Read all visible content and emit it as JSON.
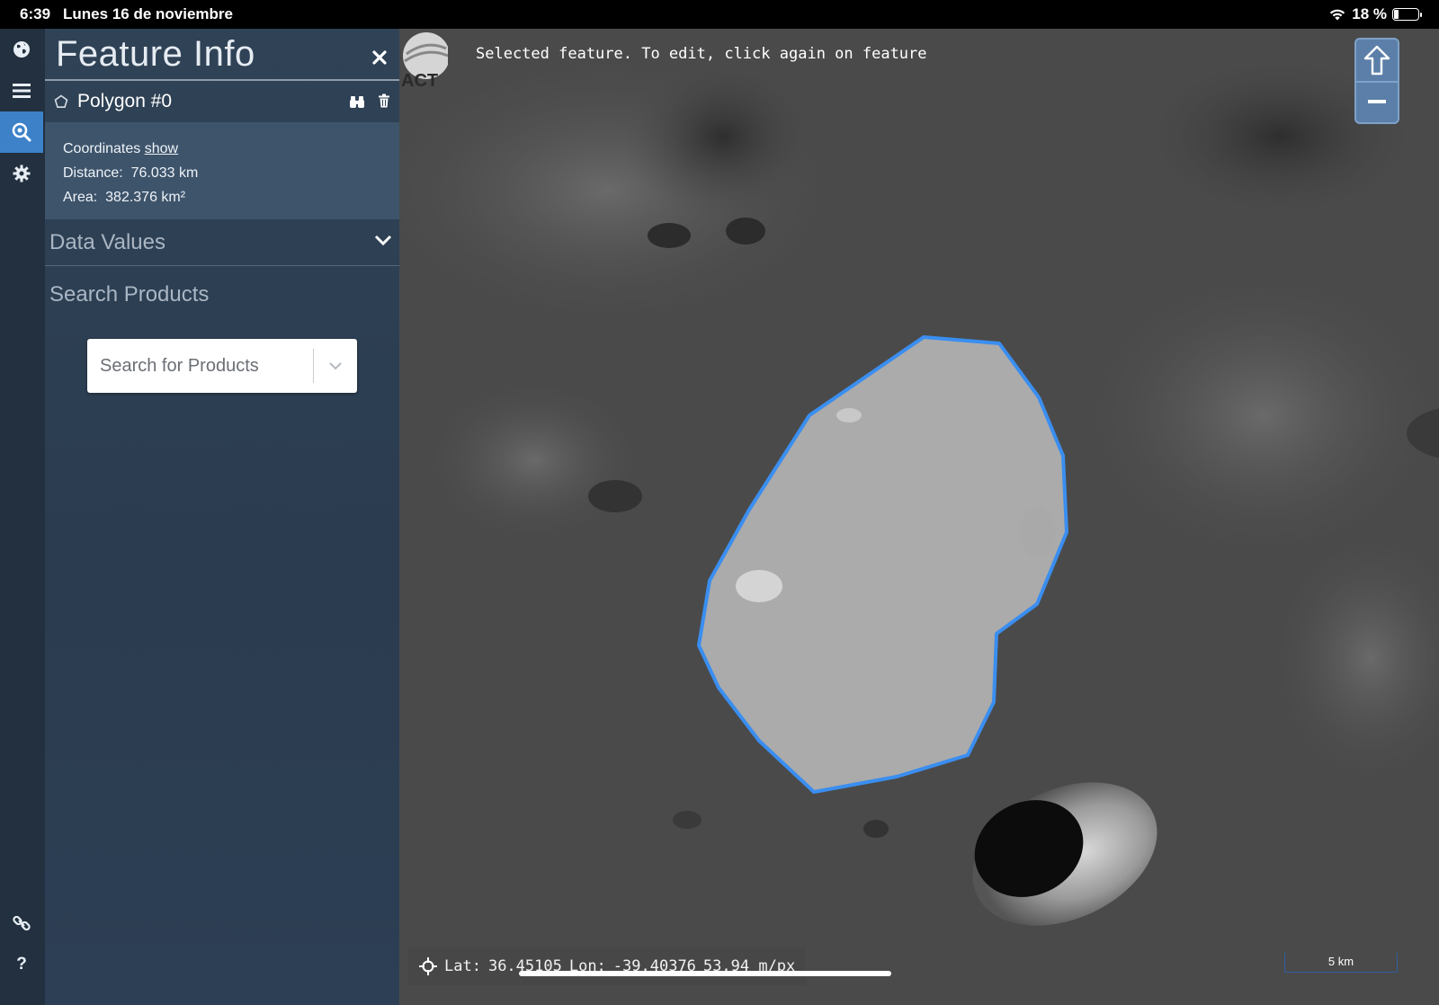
{
  "status_bar": {
    "time": "6:39",
    "date": "Lunes 16 de noviembre",
    "battery": "18 %"
  },
  "toolbar": {
    "tools": [
      "globe-icon",
      "menu-icon",
      "search-map-icon",
      "settings-icon",
      "link-icon",
      "help-icon"
    ],
    "active": "search-map-icon"
  },
  "panel": {
    "title": "Feature Info",
    "feature": {
      "name": "Polygon #0"
    },
    "coordinates_label": "Coordinates",
    "coordinates_link": "show",
    "distance_label": "Distance:",
    "distance_value": "76.033 km",
    "area_label": "Area:",
    "area_value": "382.376 km²",
    "data_values": "Data Values",
    "search_products": "Search Products",
    "search_placeholder": "Search for Products"
  },
  "map": {
    "logo_text": "ACT",
    "message": "Selected feature. To edit, click again on feature",
    "lat_label": "Lat:",
    "lat_value": "36.45105",
    "lon_label": "Lon:",
    "lon_value": "-39.40376",
    "resolution": "53.94 m/px",
    "scale": "5 km",
    "colors": {
      "polygon_stroke": "#3a8ef0",
      "active_tool": "#3d82c9",
      "panel": "#2f4256"
    }
  }
}
